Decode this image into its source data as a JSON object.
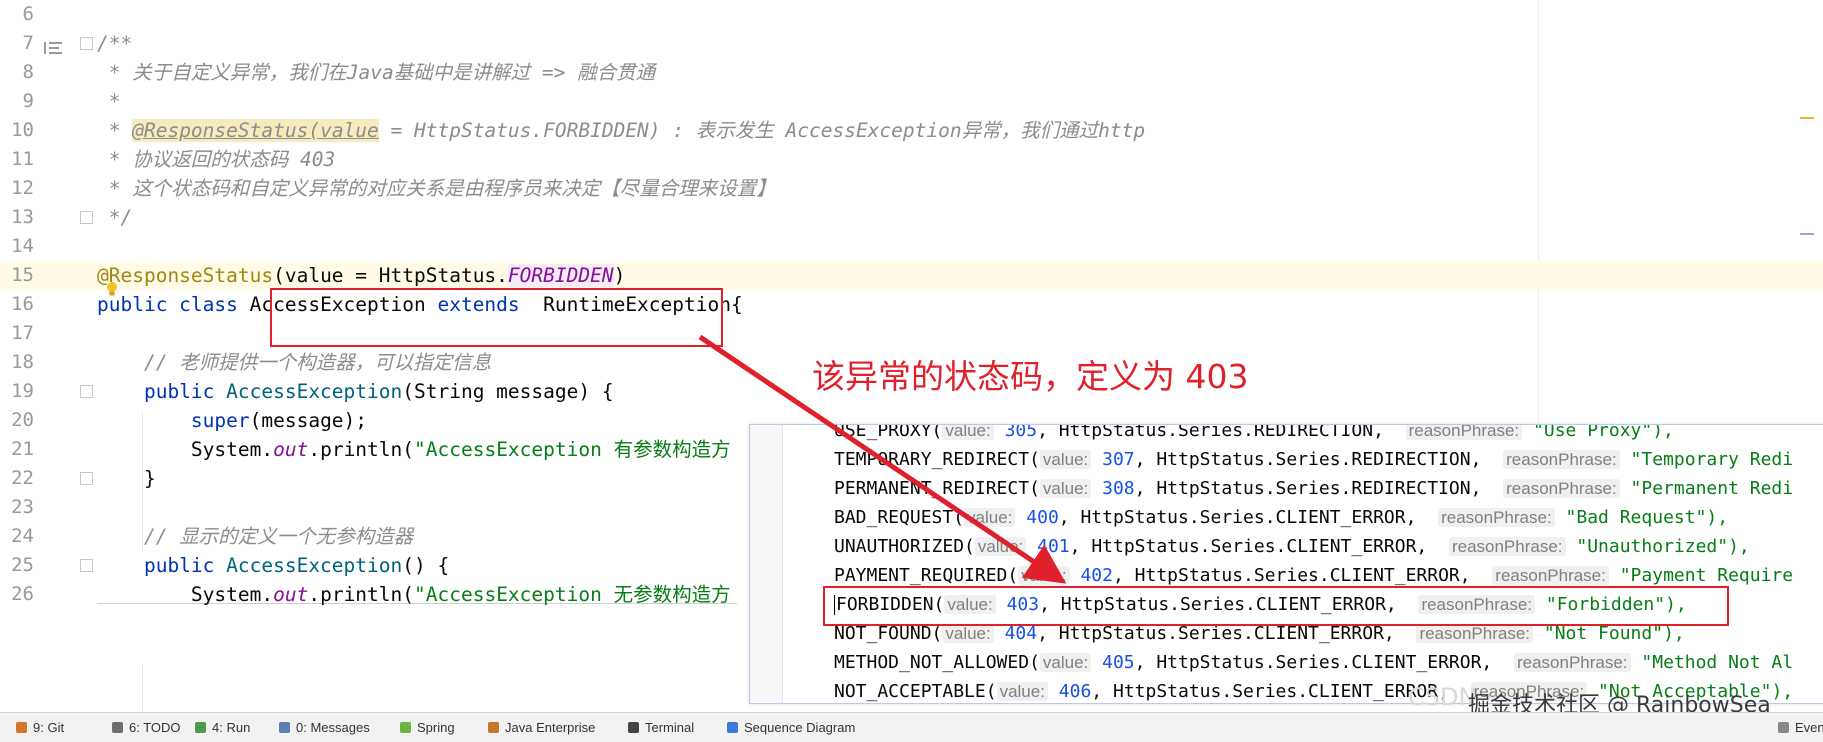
{
  "editor": {
    "lines": [
      {
        "num": "6"
      },
      {
        "num": "7",
        "segs": [
          [
            "cm",
            "/**"
          ]
        ]
      },
      {
        "num": "8",
        "segs": [
          [
            "cm",
            " * 关于自定义异常，我们在Java基础中是讲解过 => 融合贯通"
          ]
        ]
      },
      {
        "num": "9",
        "segs": [
          [
            "cm",
            " *"
          ]
        ]
      },
      {
        "num": "10",
        "segs": [
          [
            "cm",
            " * "
          ],
          [
            "cm ann-box",
            "@ResponseStatus(value"
          ],
          [
            "cm",
            " = HttpStatus.FORBIDDEN) : 表示发生 AccessException异常，我们通过http"
          ]
        ]
      },
      {
        "num": "11",
        "segs": [
          [
            "cm",
            " * 协议返回的状态码 403"
          ]
        ]
      },
      {
        "num": "12",
        "segs": [
          [
            "cm",
            " * 这个状态码和自定义异常的对应关系是由程序员来决定【尽量合理来设置】"
          ]
        ]
      },
      {
        "num": "13",
        "segs": [
          [
            "cm",
            " */"
          ]
        ]
      },
      {
        "num": "14"
      },
      {
        "num": "15",
        "segs": [
          [
            "ann",
            "@ResponseStatus"
          ],
          [
            "cls",
            "(value = HttpStatus."
          ],
          [
            "fld fldbg",
            "FORBIDDEN"
          ],
          [
            "cls",
            ")"
          ]
        ]
      },
      {
        "num": "16",
        "segs": [
          [
            "kw",
            "public class "
          ],
          [
            "cls",
            "AccessException "
          ],
          [
            "kw",
            "extends  "
          ],
          [
            "cls",
            "RuntimeException{"
          ]
        ]
      },
      {
        "num": "17"
      },
      {
        "num": "18",
        "segs": [
          [
            "cm",
            "    // 老师提供一个构造器，可以指定信息"
          ]
        ]
      },
      {
        "num": "19",
        "segs": [
          [
            "kw",
            "    public "
          ],
          [
            "ctor",
            "AccessException"
          ],
          [
            "cls",
            "(String message) {"
          ]
        ]
      },
      {
        "num": "20",
        "segs": [
          [
            "kw",
            "        super"
          ],
          [
            "cls",
            "(message);"
          ]
        ]
      },
      {
        "num": "21",
        "segs": [
          [
            "cls",
            "        System."
          ],
          [
            "fld",
            "out"
          ],
          [
            "cls",
            ".println("
          ],
          [
            "str",
            "\"AccessException 有参数构造方"
          ]
        ]
      },
      {
        "num": "22",
        "segs": [
          [
            "cls",
            "    }"
          ]
        ]
      },
      {
        "num": "23"
      },
      {
        "num": "24",
        "segs": [
          [
            "cm",
            "    // 显示的定义一个无参构造器"
          ]
        ]
      },
      {
        "num": "25",
        "segs": [
          [
            "kw",
            "    public "
          ],
          [
            "ctor",
            "AccessException"
          ],
          [
            "cls",
            "() {"
          ]
        ]
      },
      {
        "num": "26",
        "segs": [
          [
            "cls",
            "        System."
          ],
          [
            "fld",
            "out"
          ],
          [
            "cls",
            ".println("
          ],
          [
            "str",
            "\"AccessException 无参数构造方"
          ]
        ]
      }
    ]
  },
  "annotation": {
    "note": "该异常的状态码，定义为 403",
    "color": "#e0202a"
  },
  "popup": {
    "rows": [
      {
        "name": "USE_PROXY(",
        "value": "305",
        "series": "HttpStatus.Series.REDIRECTION,",
        "reason": "\"Use Proxy\"),"
      },
      {
        "name": "TEMPORARY_REDIRECT(",
        "value": "307",
        "series": "HttpStatus.Series.REDIRECTION,",
        "reason": "\"Temporary Redi"
      },
      {
        "name": "PERMANENT_REDIRECT(",
        "value": "308",
        "series": "HttpStatus.Series.REDIRECTION,",
        "reason": "\"Permanent Redi"
      },
      {
        "name": "BAD_REQUEST(",
        "value": "400",
        "series": "HttpStatus.Series.CLIENT_ERROR,",
        "reason": "\"Bad Request\"),"
      },
      {
        "name": "UNAUTHORIZED(",
        "value": "401",
        "series": "HttpStatus.Series.CLIENT_ERROR,",
        "reason": "\"Unauthorized\"),"
      },
      {
        "name": "PAYMENT_REQUIRED(",
        "value": "402",
        "series": "HttpStatus.Series.CLIENT_ERROR,",
        "reason": "\"Payment Require"
      },
      {
        "name": "FORBIDDEN(",
        "value": "403",
        "series": "HttpStatus.Series.CLIENT_ERROR,",
        "reason": "\"Forbidden\"),"
      },
      {
        "name": "NOT_FOUND(",
        "value": "404",
        "series": "HttpStatus.Series.CLIENT_ERROR,",
        "reason": "\"Not Found\"),"
      },
      {
        "name": "METHOD_NOT_ALLOWED(",
        "value": "405",
        "series": "HttpStatus.Series.CLIENT_ERROR,",
        "reason": "\"Method Not Al"
      },
      {
        "name": "NOT_ACCEPTABLE(",
        "value": "406",
        "series": "HttpStatus.Series.CLIENT_ERROR,",
        "reason": "\"Not Acceptable\"),"
      }
    ],
    "hint_value": "value:",
    "hint_reason": "reasonPhrase:"
  },
  "statusbar": {
    "items": [
      {
        "label": "9: Git",
        "icon": "git-icon",
        "color": "#d4772c"
      },
      {
        "label": "6: TODO",
        "icon": "todo-icon",
        "color": "#6e6e6e"
      },
      {
        "label": "4: Run",
        "icon": "run-icon",
        "color": "#4a9b4a"
      },
      {
        "label": "0: Messages",
        "icon": "messages-icon",
        "color": "#5a7fb5"
      },
      {
        "label": "Spring",
        "icon": "spring-icon",
        "color": "#6db33f"
      },
      {
        "label": "Java Enterprise",
        "icon": "java-enterprise-icon",
        "color": "#c27a2a"
      },
      {
        "label": "Terminal",
        "icon": "terminal-icon",
        "color": "#444444"
      },
      {
        "label": "Sequence Diagram",
        "icon": "sequence-diagram-icon",
        "color": "#3b7bd6"
      },
      {
        "label": "Even",
        "icon": "event-log-icon",
        "color": "#888888"
      }
    ]
  },
  "watermark": {
    "csdn": "CSDN",
    "text": "掘金技术社区 @ RainbowSea"
  }
}
